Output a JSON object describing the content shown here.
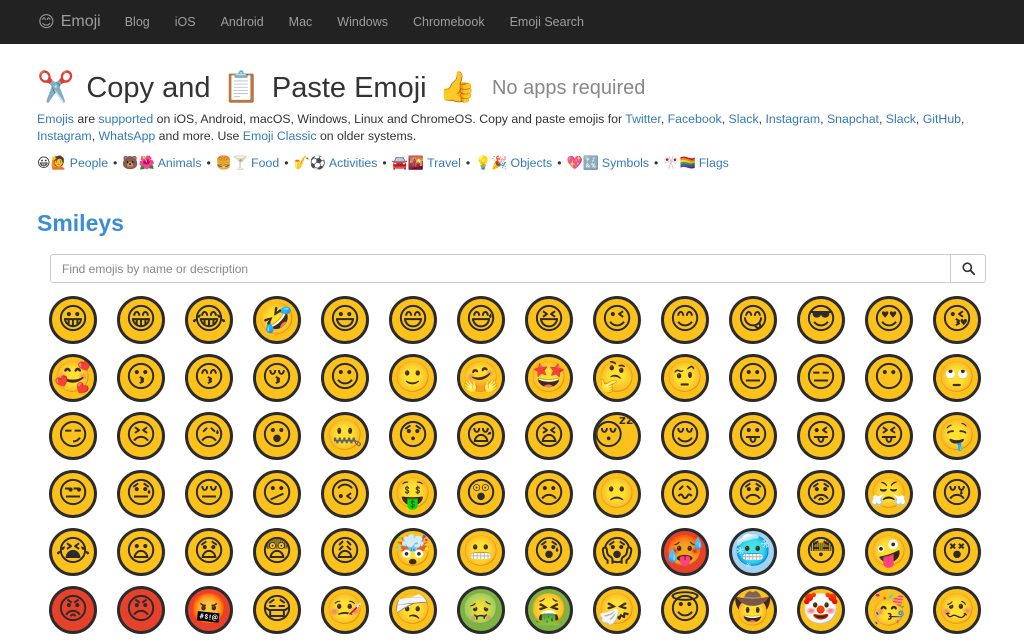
{
  "brand": {
    "icon": "😊",
    "name": "Emoji"
  },
  "nav": [
    "Blog",
    "iOS",
    "Android",
    "Mac",
    "Windows",
    "Chromebook",
    "Emoji Search"
  ],
  "title": {
    "emoji1": "✂️",
    "part1": "Copy and",
    "emoji2": "📋",
    "part2": "Paste Emoji",
    "emoji3": "👍",
    "subtitle": "No apps required"
  },
  "intro": {
    "l1": "Emojis",
    "t1": " are ",
    "l2": "supported",
    "t2": " on iOS, Android, macOS, Windows, Linux and ChromeOS. Copy and paste emojis for ",
    "l3": "Twitter",
    "l4": "Facebook",
    "l5": "Slack",
    "l6": "Instagram",
    "l7": "Snapchat",
    "l8": "Slack",
    "l9": "GitHub",
    "l10": "Instagram",
    "l11": "WhatsApp",
    "t3": " and more. Use ",
    "l12": "Emoji Classic",
    "t4": " on older systems.",
    "sep": ", "
  },
  "categories": [
    {
      "icons": "😀🙋",
      "label": "People"
    },
    {
      "icons": "🐻🌺",
      "label": "Animals"
    },
    {
      "icons": "🍔🍸",
      "label": "Food"
    },
    {
      "icons": "🎷⚽",
      "label": "Activities"
    },
    {
      "icons": "🚘🌇",
      "label": "Travel"
    },
    {
      "icons": "💡🎉",
      "label": "Objects"
    },
    {
      "icons": "💖🔣",
      "label": "Symbols"
    },
    {
      "icons": "🎌🏳️‍🌈",
      "label": "Flags"
    }
  ],
  "category_separator": "•",
  "section": {
    "title": "Smileys"
  },
  "search": {
    "placeholder": "Find emojis by name or description",
    "icon": "search-icon"
  },
  "emojis": [
    {
      "name": "grinning face",
      "g": "😀"
    },
    {
      "name": "grinning face with smiling eyes",
      "g": "😁"
    },
    {
      "name": "face with tears of joy",
      "g": "😂"
    },
    {
      "name": "rolling on the floor laughing",
      "g": "🤣"
    },
    {
      "name": "smiling face with open mouth",
      "g": "😃"
    },
    {
      "name": "smiling face with open mouth and smiling eyes",
      "g": "😄"
    },
    {
      "name": "smiling face with open mouth and cold sweat",
      "g": "😅"
    },
    {
      "name": "smiling face with open mouth and tightly-closed eyes",
      "g": "😆"
    },
    {
      "name": "winking face",
      "g": "😉"
    },
    {
      "name": "smiling face with smiling eyes",
      "g": "😊"
    },
    {
      "name": "face savouring delicious food",
      "g": "😋"
    },
    {
      "name": "smiling face with sunglasses",
      "g": "😎"
    },
    {
      "name": "smiling face with heart-shaped eyes",
      "g": "😍"
    },
    {
      "name": "face throwing a kiss",
      "g": "😘"
    },
    {
      "name": "smiling face with hearts",
      "g": "🥰"
    },
    {
      "name": "kissing face",
      "g": "😗"
    },
    {
      "name": "kissing face with smiling eyes",
      "g": "😙"
    },
    {
      "name": "kissing face with closed eyes",
      "g": "😚"
    },
    {
      "name": "white smiling face",
      "g": "☺"
    },
    {
      "name": "slightly smiling face",
      "g": "🙂"
    },
    {
      "name": "hugging face",
      "g": "🤗"
    },
    {
      "name": "star-struck",
      "g": "🤩"
    },
    {
      "name": "thinking face",
      "g": "🤔"
    },
    {
      "name": "face with raised eyebrow",
      "g": "🤨"
    },
    {
      "name": "neutral face",
      "g": "😐"
    },
    {
      "name": "expressionless face",
      "g": "😑"
    },
    {
      "name": "face without mouth",
      "g": "😶"
    },
    {
      "name": "face with rolling eyes",
      "g": "🙄"
    },
    {
      "name": "smirking face",
      "g": "😏"
    },
    {
      "name": "persevering face",
      "g": "😣"
    },
    {
      "name": "disappointed but relieved face",
      "g": "😥"
    },
    {
      "name": "face with open mouth",
      "g": "😮"
    },
    {
      "name": "zipper-mouth face",
      "g": "🤐"
    },
    {
      "name": "hushed face",
      "g": "😯"
    },
    {
      "name": "sleepy face",
      "g": "😪"
    },
    {
      "name": "tired face",
      "g": "😫"
    },
    {
      "name": "sleeping face",
      "g": "😴"
    },
    {
      "name": "relieved face",
      "g": "😌"
    },
    {
      "name": "face with stuck-out tongue",
      "g": "😛"
    },
    {
      "name": "face with stuck-out tongue and winking eye",
      "g": "😜"
    },
    {
      "name": "face with stuck-out tongue and tightly-closed eyes",
      "g": "😝"
    },
    {
      "name": "drooling face",
      "g": "🤤"
    },
    {
      "name": "unamused face",
      "g": "😒"
    },
    {
      "name": "face with cold sweat",
      "g": "😓"
    },
    {
      "name": "pensive face",
      "g": "😔"
    },
    {
      "name": "confused face",
      "g": "😕"
    },
    {
      "name": "upside-down face",
      "g": "🙃"
    },
    {
      "name": "money-mouth face",
      "g": "🤑"
    },
    {
      "name": "astonished face",
      "g": "😲"
    },
    {
      "name": "frowning face",
      "g": "☹"
    },
    {
      "name": "slightly frowning face",
      "g": "🙁"
    },
    {
      "name": "confounded face",
      "g": "😖"
    },
    {
      "name": "disappointed face",
      "g": "😞"
    },
    {
      "name": "worried face",
      "g": "😟"
    },
    {
      "name": "face with look of triumph",
      "g": "😤"
    },
    {
      "name": "crying face",
      "g": "😢"
    },
    {
      "name": "loudly crying face",
      "g": "😭"
    },
    {
      "name": "frowning face with open mouth",
      "g": "😦"
    },
    {
      "name": "anguished face",
      "g": "😧"
    },
    {
      "name": "fearful face",
      "g": "😨"
    },
    {
      "name": "weary face",
      "g": "😩"
    },
    {
      "name": "shocked face with exploding head",
      "g": "🤯"
    },
    {
      "name": "grimacing face",
      "g": "😬"
    },
    {
      "name": "face with open mouth and cold sweat",
      "g": "😰"
    },
    {
      "name": "face screaming in fear",
      "g": "😱"
    },
    {
      "name": "overheated face",
      "g": "🥵"
    },
    {
      "name": "freezing face",
      "g": "🥶"
    },
    {
      "name": "flushed face",
      "g": "😳"
    },
    {
      "name": "zany face",
      "g": "🤪"
    },
    {
      "name": "dizzy face",
      "g": "😵"
    },
    {
      "name": "pouting face",
      "g": "😡"
    },
    {
      "name": "angry face",
      "g": "😠"
    },
    {
      "name": "face with symbols on mouth",
      "g": "🤬"
    },
    {
      "name": "face with medical mask",
      "g": "😷"
    },
    {
      "name": "face with thermometer",
      "g": "🤒"
    },
    {
      "name": "face with head-bandage",
      "g": "🤕"
    },
    {
      "name": "nauseated face",
      "g": "🤢"
    },
    {
      "name": "face vomiting",
      "g": "🤮"
    },
    {
      "name": "sneezing face",
      "g": "🤧"
    },
    {
      "name": "smiling face with halo",
      "g": "😇"
    },
    {
      "name": "cowboy hat face",
      "g": "🤠"
    },
    {
      "name": "clown face",
      "g": "🤡"
    },
    {
      "name": "partying face",
      "g": "🥳"
    },
    {
      "name": "woozy face",
      "g": "🥴"
    }
  ],
  "colors": {
    "navbar": "#222222",
    "link": "#337ab7",
    "section_title": "#3a8ed6",
    "emoji_yellow": "#fcc21b"
  }
}
